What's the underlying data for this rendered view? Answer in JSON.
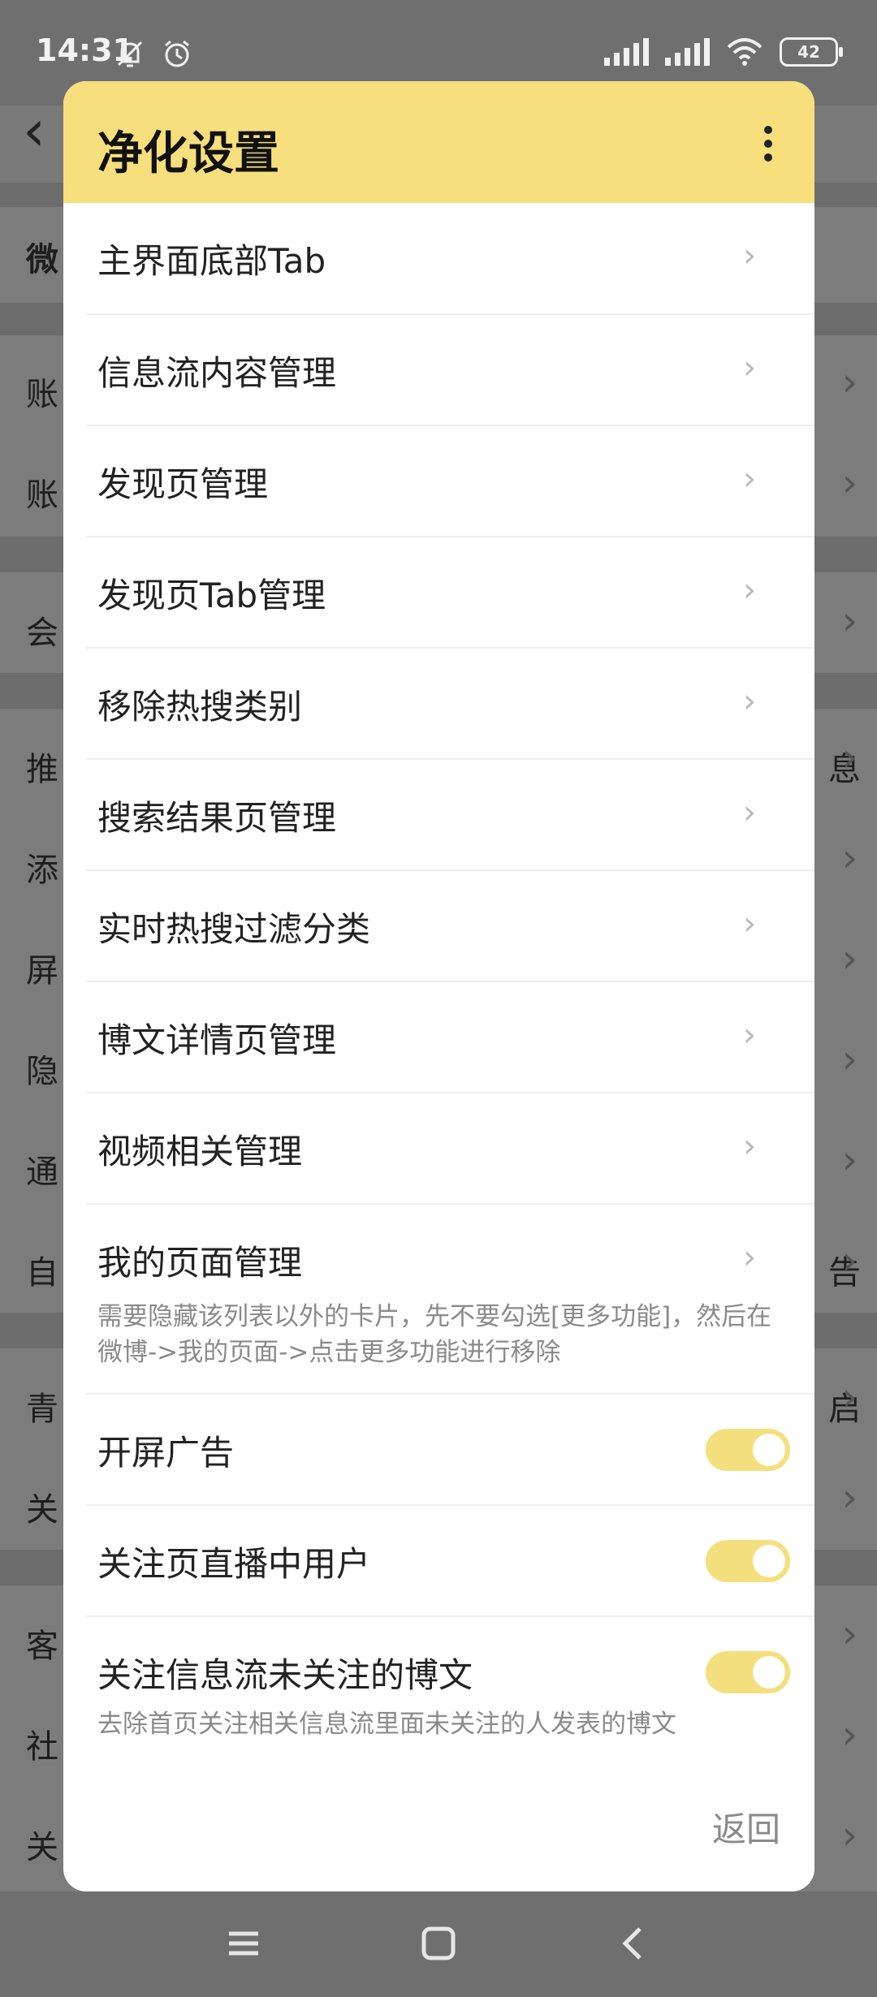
{
  "status_bar": {
    "time": "14:31",
    "battery": "42",
    "icons": [
      "bell-off-icon",
      "alarm-icon",
      "hd-signal-icon",
      "signal-icon",
      "wifi-icon",
      "battery-icon"
    ]
  },
  "background": {
    "rows": [
      {
        "label": "微",
        "top": 0
      },
      {
        "label": "账"
      },
      {
        "label": "账"
      },
      {
        "label": "会"
      },
      {
        "label": "推",
        "trailing": "息"
      },
      {
        "label": "添"
      },
      {
        "label": "屏"
      },
      {
        "label": "隐"
      },
      {
        "label": "通"
      },
      {
        "label": "自",
        "trailing": "告"
      },
      {
        "label": "青",
        "trailing": "启"
      },
      {
        "label": "关"
      },
      {
        "label": "客"
      },
      {
        "label": "社"
      },
      {
        "label": "关"
      }
    ]
  },
  "dialog": {
    "title": "净化设置",
    "items": [
      {
        "label": "主界面底部Tab"
      },
      {
        "label": "信息流内容管理"
      },
      {
        "label": "发现页管理"
      },
      {
        "label": "发现页Tab管理"
      },
      {
        "label": "移除热搜类别"
      },
      {
        "label": "搜索结果页管理"
      },
      {
        "label": "实时热搜过滤分类"
      },
      {
        "label": "博文详情页管理"
      },
      {
        "label": "视频相关管理"
      },
      {
        "label": "我的页面管理",
        "desc": "需要隐藏该列表以外的卡片，先不要勾选[更多功能]，然后在微博->我的页面->点击更多功能进行移除"
      }
    ],
    "toggles": [
      {
        "label": "开屏广告",
        "on": true
      },
      {
        "label": "关注页直播中用户",
        "on": true
      },
      {
        "label": "关注信息流未关注的博文",
        "on": true,
        "desc": "去除首页关注相关信息流里面未关注的人发表的博文"
      }
    ],
    "back_label": "返回",
    "accent_color": "#f7df7d"
  }
}
